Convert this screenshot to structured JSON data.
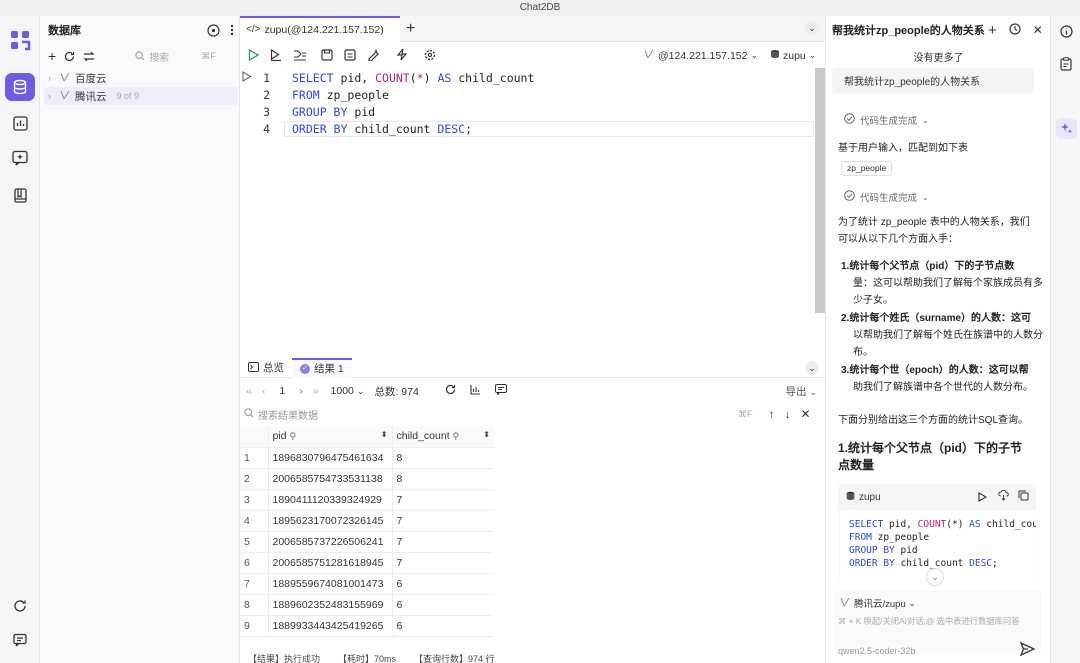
{
  "app": {
    "title": "Chat2DB"
  },
  "dbpanel": {
    "title": "数据库",
    "search_placeholder": "搜索",
    "search_shortcut": "⌘F",
    "items": [
      {
        "label": "百度云",
        "sub": ""
      },
      {
        "label": "腾讯云",
        "sub": "9 of 9"
      }
    ]
  },
  "editor": {
    "tab_label": "zupu(@124.221.157.152)",
    "connection": "@124.221.157.152",
    "database": "zupu",
    "lines": [
      "1",
      "2",
      "3",
      "4"
    ]
  },
  "results": {
    "tab_overview": "总览",
    "tab_result": "结果 1",
    "page": "1",
    "page_size": "1000",
    "total_label": "总数: 974",
    "export_label": "导出",
    "search_placeholder": "搜索结果数据",
    "search_shortcut": "⌘F",
    "columns": [
      "pid",
      "child_count"
    ],
    "rows": [
      [
        "1",
        "1896830796475461634",
        "8"
      ],
      [
        "2",
        "2006585754733531138",
        "8"
      ],
      [
        "3",
        "1890411120339324929",
        "7"
      ],
      [
        "4",
        "1895623170072326145",
        "7"
      ],
      [
        "5",
        "2006585737226506241",
        "7"
      ],
      [
        "6",
        "2006585751281618945",
        "7"
      ],
      [
        "7",
        "1889559674081001473",
        "6"
      ],
      [
        "8",
        "1889602352483155969",
        "6"
      ],
      [
        "9",
        "1889933443425419265",
        "6"
      ]
    ],
    "status_1": "【结果】执行成功",
    "status_2": "【耗时】70ms",
    "status_3": "【查询行数】974 行"
  },
  "chat": {
    "title": "帮我统计zp_people的人物关系",
    "no_more": "没有更多了",
    "user_msg": "帮我统计zp_people的人物关系",
    "gen_done_1": "代码生成完成",
    "match_text": "基于用户输入，匹配到如下表",
    "table_tag": "zp_people",
    "gen_done_2": "代码生成完成",
    "intro_1": "为了统计 zp_people 表中的人物关系，我们",
    "intro_2": "可以从以下几个方面入手：",
    "list": [
      {
        "n": "1.",
        "l1": "统计每个父节点（pid）下的子节点数",
        "l2": "量：这可以帮助我们了解每个家族成员有多",
        "l3": "少子女。"
      },
      {
        "n": "2.",
        "l1": "统计每个姓氏（surname）的人数：这可",
        "l2": "以帮助我们了解每个姓氏在族谱中的人数分",
        "l3": "布。"
      },
      {
        "n": "3.",
        "l1": "统计每个世（epoch）的人数：这可以帮",
        "l2": "助我们了解族谱中各个世代的人数分布。",
        "l3": ""
      }
    ],
    "followup": "下面分别给出这三个方面的统计SQL查询。",
    "h1_a": "1.统计每个父节点（pid）下的子节",
    "h1_b": "点数量",
    "code_db": "zupu",
    "input_conn": "腾讯云/zupu",
    "input_placeholder": "⌘ + K 唤起/关闭AI对话,@ 选中表进行数据库问答",
    "model": "qwen2.5-coder-32b"
  }
}
